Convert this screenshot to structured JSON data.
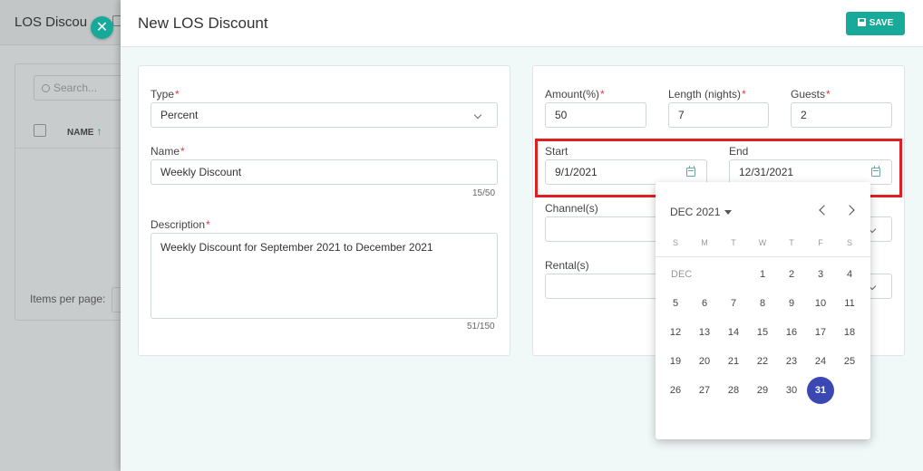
{
  "background": {
    "title": "LOS Discou",
    "search_placeholder": "Search...",
    "column_name": "NAME",
    "items_per_page_label": "Items per page:"
  },
  "drawer": {
    "title": "New LOS Discount",
    "save_label": "SAVE"
  },
  "form": {
    "type": {
      "label": "Type",
      "value": "Percent"
    },
    "name": {
      "label": "Name",
      "value": "Weekly Discount",
      "counter": "15/50"
    },
    "description": {
      "label": "Description",
      "value": "Weekly Discount for September 2021 to December 2021",
      "counter": "51/150"
    },
    "amount": {
      "label": "Amount(%)",
      "value": "50"
    },
    "length": {
      "label": "Length (nights)",
      "value": "7"
    },
    "guests": {
      "label": "Guests",
      "value": "2"
    },
    "start": {
      "label": "Start",
      "value": "9/1/2021"
    },
    "end": {
      "label": "End",
      "value": "12/31/2021"
    },
    "channels": {
      "label": "Channel(s)"
    },
    "rentals": {
      "label": "Rental(s)"
    },
    "required_mark": "*"
  },
  "calendar": {
    "month_label": "DEC 2021",
    "month_short": "DEC",
    "weekdays": [
      "S",
      "M",
      "T",
      "W",
      "T",
      "F",
      "S"
    ],
    "weeks": [
      [
        "",
        "",
        "",
        "1",
        "2",
        "3",
        "4"
      ],
      [
        "5",
        "6",
        "7",
        "8",
        "9",
        "10",
        "11"
      ],
      [
        "12",
        "13",
        "14",
        "15",
        "16",
        "17",
        "18"
      ],
      [
        "19",
        "20",
        "21",
        "22",
        "23",
        "24",
        "25"
      ],
      [
        "26",
        "27",
        "28",
        "29",
        "30",
        "31",
        ""
      ]
    ],
    "selected_day": "31"
  },
  "colors": {
    "accent": "#17a999",
    "selected_day": "#3b48b4",
    "highlight": "#e02020",
    "required": "#e03b3b"
  }
}
